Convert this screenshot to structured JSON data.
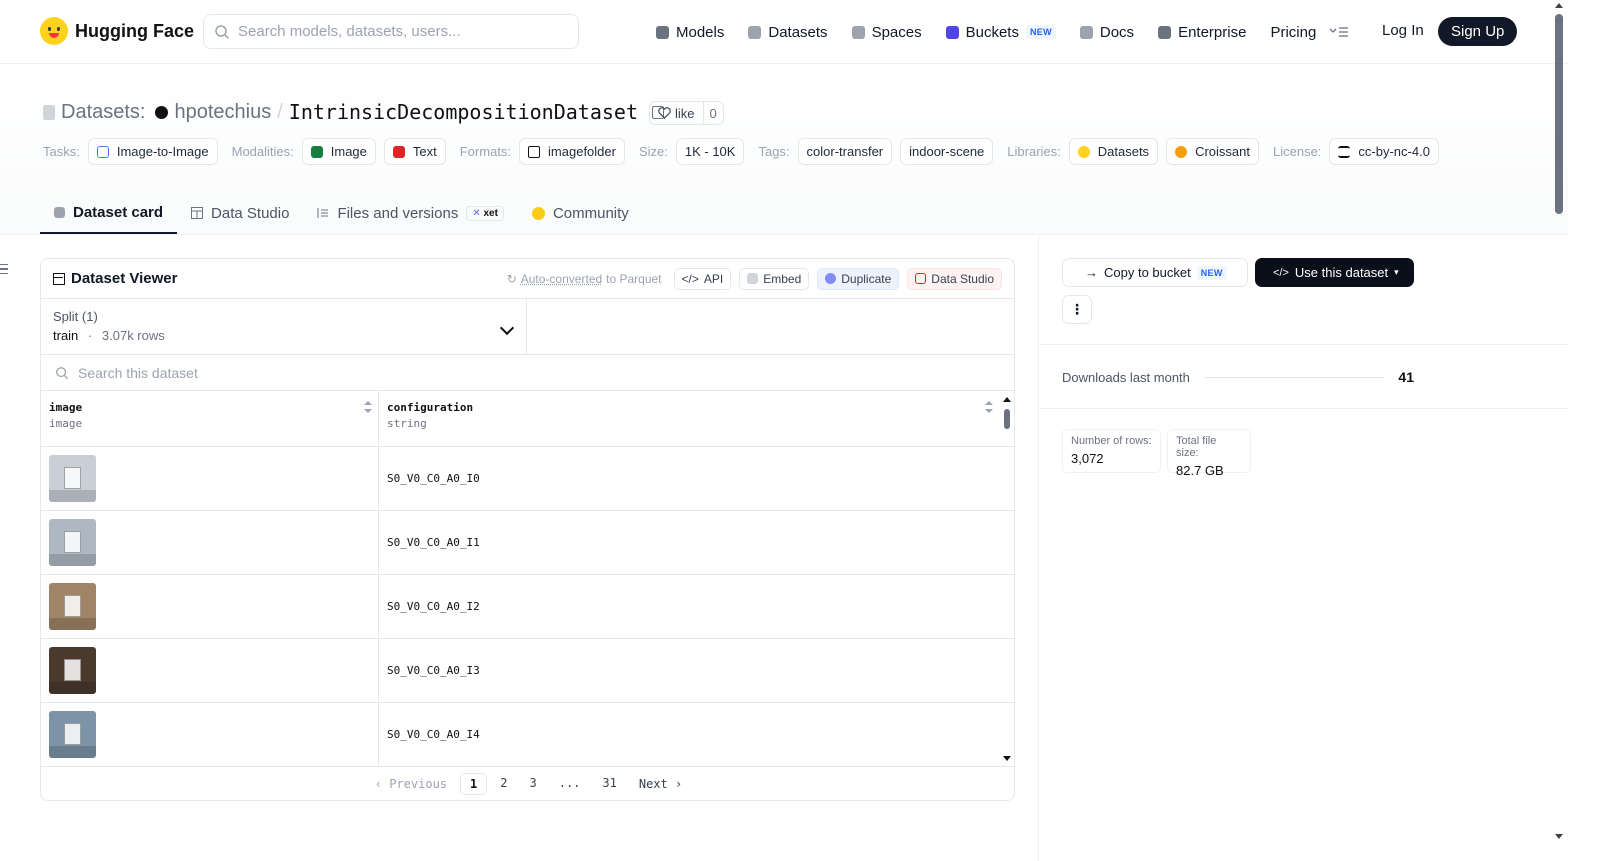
{
  "nav": {
    "brand": "Hugging Face",
    "search_placeholder": "Search models, datasets, users...",
    "links": [
      {
        "label": "Models",
        "icon": "cube-icon",
        "color": "#6b7280"
      },
      {
        "label": "Datasets",
        "icon": "database-icon",
        "color": "#9ca3af"
      },
      {
        "label": "Spaces",
        "icon": "grid-icon",
        "color": "#9ca3af"
      },
      {
        "label": "Buckets",
        "icon": "bucket-icon",
        "color": "#4f46e5",
        "badge": "NEW"
      },
      {
        "label": "Docs",
        "icon": "book-icon",
        "color": "#9ca3af"
      },
      {
        "label": "Enterprise",
        "icon": "enterprise-icon",
        "color": "#6b7280"
      },
      {
        "label": "Pricing"
      }
    ],
    "login": "Log In",
    "signup": "Sign Up"
  },
  "header": {
    "section": "Datasets:",
    "owner": "hpotechius",
    "separator": "/",
    "name": "IntrinsicDecompositionDataset",
    "like_label": "like",
    "like_count": "0"
  },
  "tags": {
    "tasks_label": "Tasks:",
    "tasks": [
      "Image-to-Image"
    ],
    "modalities_label": "Modalities:",
    "modalities": [
      "Image",
      "Text"
    ],
    "formats_label": "Formats:",
    "formats": [
      "imagefolder"
    ],
    "size_label": "Size:",
    "size": "1K - 10K",
    "tags_label": "Tags:",
    "tag_list": [
      "color-transfer",
      "indoor-scene"
    ],
    "libraries_label": "Libraries:",
    "libraries": [
      "Datasets",
      "Croissant"
    ],
    "license_label": "License:",
    "license": "cc-by-nc-4.0"
  },
  "tabs": [
    {
      "label": "Dataset card",
      "active": true
    },
    {
      "label": "Data Studio"
    },
    {
      "label": "Files and versions",
      "badge": "xet"
    },
    {
      "label": "Community"
    }
  ],
  "viewer": {
    "title": "Dataset Viewer",
    "auto_converted": "Auto-converted",
    "auto_converted_suffix": "to Parquet",
    "api": "API",
    "embed": "Embed",
    "duplicate": "Duplicate",
    "data_studio": "Data Studio",
    "split_label": "Split (1)",
    "split_name": "train",
    "split_dot": "·",
    "split_rows": "3.07k rows",
    "search_placeholder": "Search this dataset",
    "columns": [
      {
        "name": "image",
        "type": "image"
      },
      {
        "name": "configuration",
        "type": "string"
      }
    ],
    "rows": [
      {
        "configuration": "S0_V0_C0_A0_I0",
        "tone": "#c9cfd6"
      },
      {
        "configuration": "S0_V0_C0_A0_I1",
        "tone": "#aeb8c2"
      },
      {
        "configuration": "S0_V0_C0_A0_I2",
        "tone": "#a08466"
      },
      {
        "configuration": "S0_V0_C0_A0_I3",
        "tone": "#4a3a2e"
      },
      {
        "configuration": "S0_V0_C0_A0_I4",
        "tone": "#7d93a8"
      }
    ],
    "pager": {
      "prev": "Previous",
      "pages": [
        "1",
        "2",
        "3",
        "...",
        "31"
      ],
      "current": "1",
      "next": "Next"
    }
  },
  "side": {
    "copy_to_bucket": "Copy to bucket",
    "new_badge": "NEW",
    "use_dataset": "Use this dataset",
    "downloads_label": "Downloads last month",
    "downloads_value": "41",
    "stats": [
      {
        "label": "Number of rows:",
        "value": "3,072"
      },
      {
        "label": "Total file size:",
        "value": "82.7 GB"
      }
    ]
  }
}
